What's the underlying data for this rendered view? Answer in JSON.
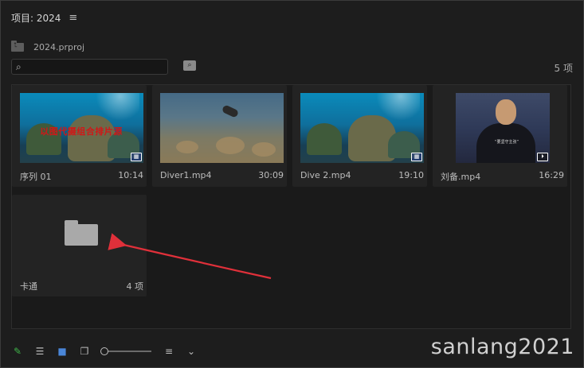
{
  "header": {
    "title": "项目: 2024",
    "menu_icon": "hamburger-menu-icon"
  },
  "path": {
    "label": "2024.prproj"
  },
  "search": {
    "placeholder": "",
    "value": ""
  },
  "count_label": "5 项",
  "tiles": [
    {
      "name": "序列 01",
      "duration": "10:14",
      "type": "sequence",
      "subtitle": "以图代摄组合排片源"
    },
    {
      "name": "Diver1.mp4",
      "duration": "30:09",
      "type": "video"
    },
    {
      "name": "Dive 2.mp4",
      "duration": "19:10",
      "type": "sequence"
    },
    {
      "name": "刘备.mp4",
      "duration": "16:29",
      "type": "audio-video",
      "caption": "“要坚守主张”"
    }
  ],
  "folder": {
    "name": "卡通",
    "count": "4 项"
  },
  "annotation": {
    "arrow_color": "#e0303a"
  },
  "watermark": "sanlang2021",
  "bottom_bar": {
    "icons": [
      "pencil-icon",
      "list-view-icon",
      "icon-view-icon",
      "freeform-view-icon",
      "zoom-slider",
      "sort-icon",
      "chevron-down-icon"
    ]
  }
}
